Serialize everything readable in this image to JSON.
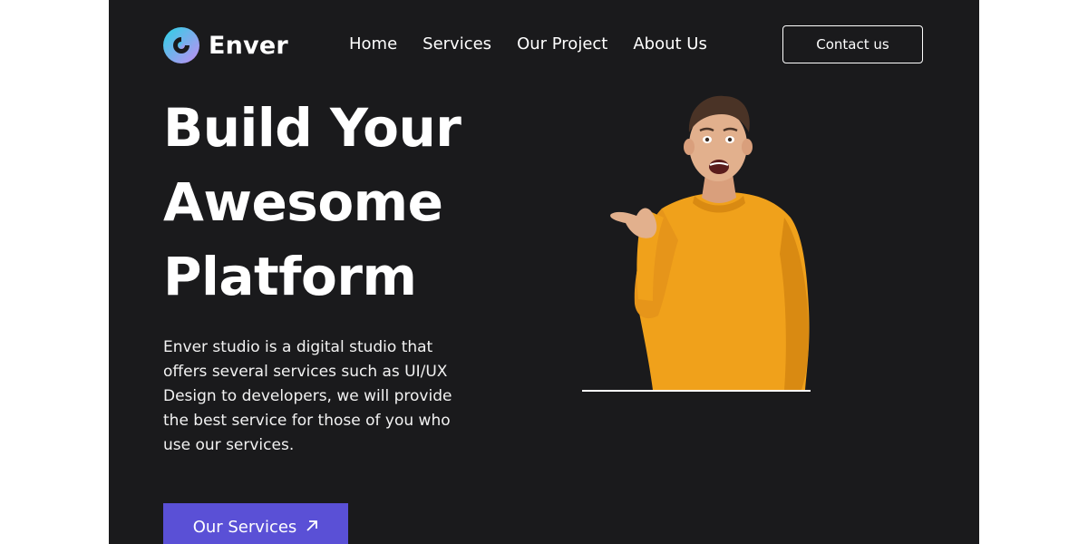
{
  "brand": {
    "name": "Enver",
    "logo_icon": "enver-logo-icon",
    "logo_colors": [
      "#2ad3e6",
      "#b38cf2"
    ]
  },
  "nav": {
    "items": [
      {
        "label": "Home"
      },
      {
        "label": "Services"
      },
      {
        "label": "Our Project"
      },
      {
        "label": "About Us"
      }
    ]
  },
  "header": {
    "contact_label": "Contact us"
  },
  "hero": {
    "title_lines": [
      "Build Your",
      "Awesome",
      "Platform"
    ],
    "description": "Enver studio is a digital studio that offers several services such as UI/UX Design to developers, we will provide the best service for those of you who use our services.",
    "cta_label": "Our Services",
    "cta_icon": "arrow-up-right-icon",
    "image": "man-in-orange-sweater-pointing-photo"
  },
  "colors": {
    "background": "#1a1a1c",
    "accent": "#5a50d6",
    "sweater": "#f0a11b"
  }
}
